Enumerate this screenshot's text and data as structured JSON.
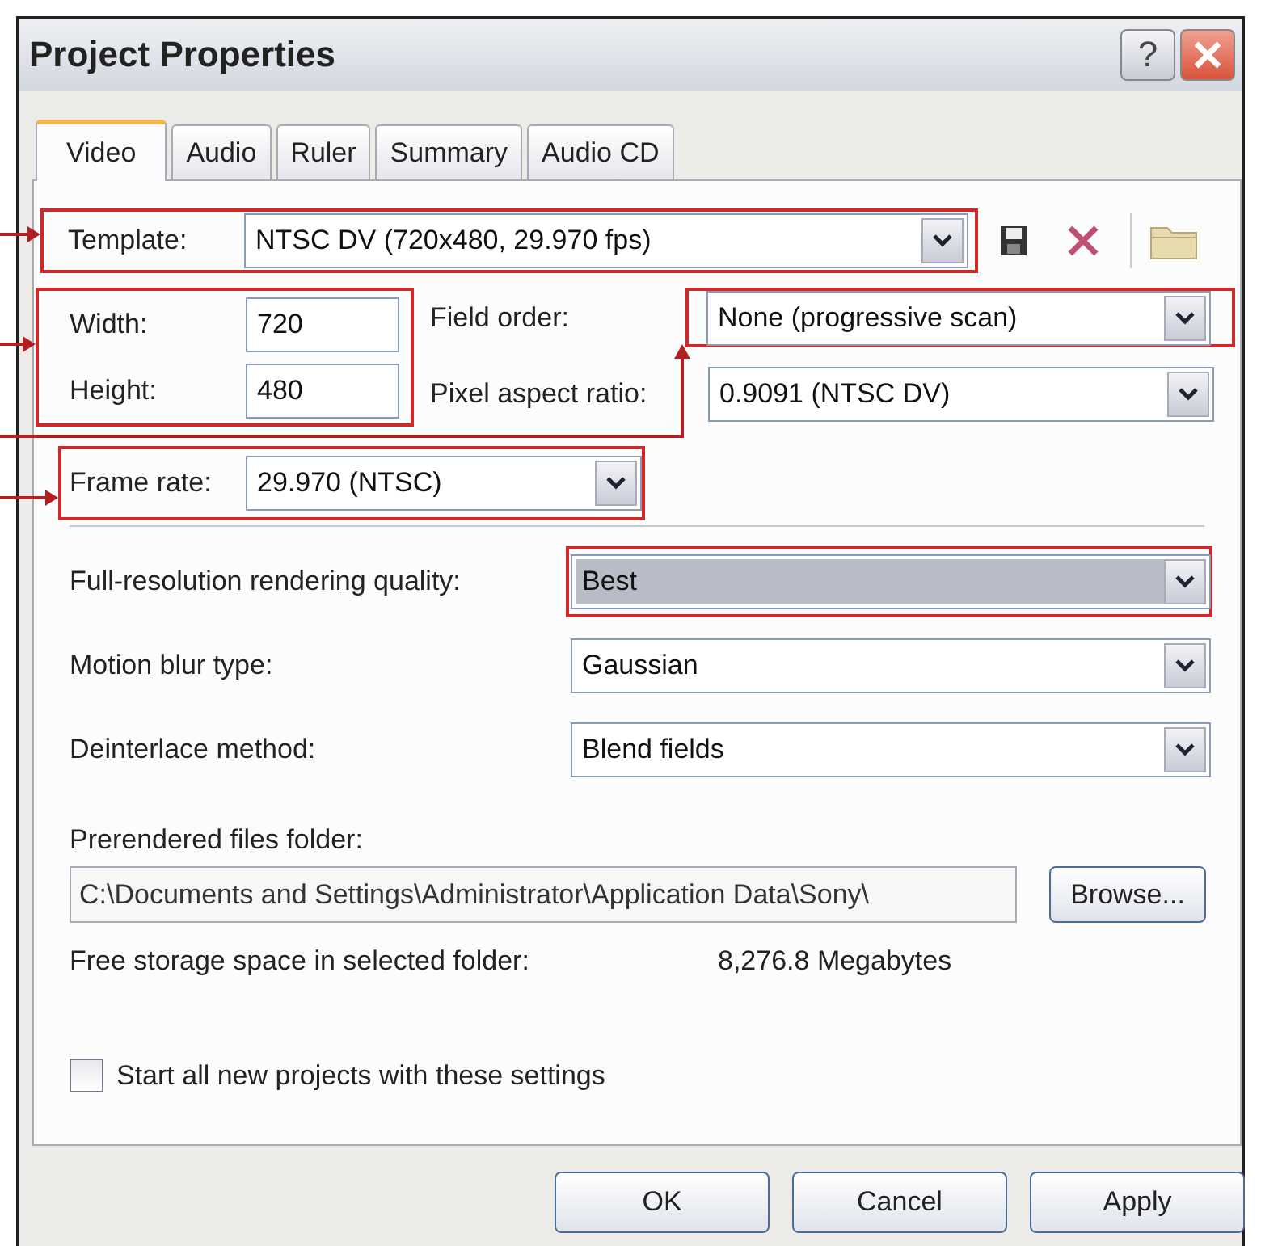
{
  "window": {
    "title": "Project Properties",
    "help_button": "?"
  },
  "tabs": [
    {
      "label": "Video",
      "selected": true
    },
    {
      "label": "Audio",
      "selected": false
    },
    {
      "label": "Ruler",
      "selected": false
    },
    {
      "label": "Summary",
      "selected": false
    },
    {
      "label": "Audio CD",
      "selected": false
    }
  ],
  "template": {
    "label": "Template:",
    "value": "NTSC DV (720x480, 29.970 fps)",
    "annotated": true
  },
  "size": {
    "annotated": true,
    "fields": [
      {
        "label": "Width:",
        "value": "720"
      },
      {
        "label": "Height:",
        "value": "480"
      }
    ]
  },
  "field_order": {
    "label": "Field order:",
    "value": "None (progressive scan)",
    "annotated": true
  },
  "pixel_aspect_ratio": {
    "label": "Pixel aspect ratio:",
    "value": "0.9091 (NTSC DV)"
  },
  "frame_rate": {
    "label": "Frame rate:",
    "value": "29.970 (NTSC)",
    "annotated": true
  },
  "quality_settings": [
    {
      "label": "Full-resolution rendering quality:",
      "value": "Best",
      "highlighted": true,
      "annotated": true
    },
    {
      "label": "Motion blur type:",
      "value": "Gaussian",
      "highlighted": false,
      "annotated": false
    },
    {
      "label": "Deinterlace method:",
      "value": "Blend fields",
      "highlighted": false,
      "annotated": false
    }
  ],
  "prerendered": {
    "label": "Prerendered files folder:",
    "path": "C:\\Documents and Settings\\Administrator\\Application Data\\Sony\\",
    "button": "Browse..."
  },
  "free_storage": {
    "label": "Free storage space in selected folder:",
    "value": "8,276.8 Megabytes"
  },
  "start_all": {
    "label": "Start all new projects with these settings",
    "checked": false
  },
  "buttons": [
    "OK",
    "Cancel",
    "Apply"
  ]
}
